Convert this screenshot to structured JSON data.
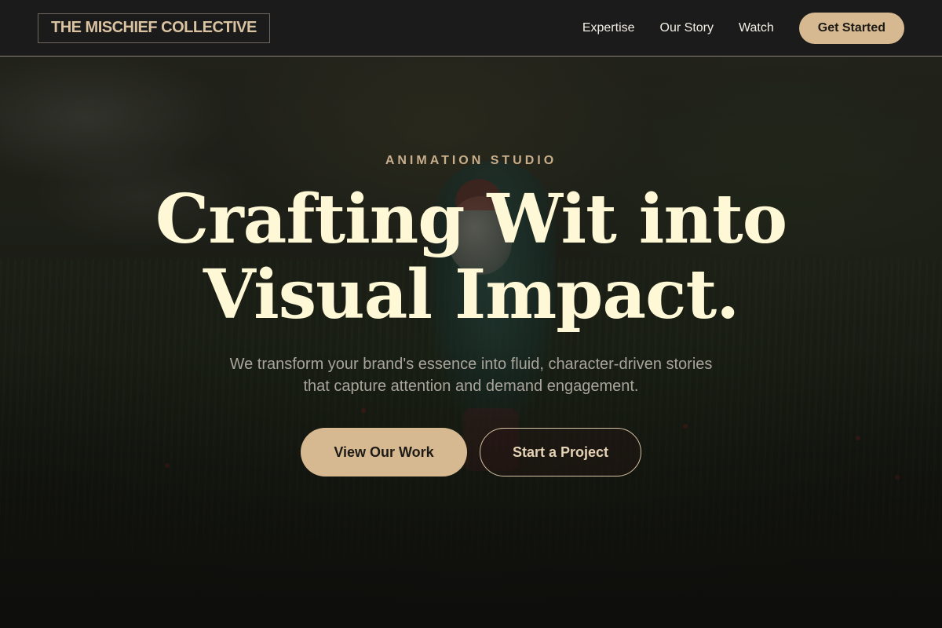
{
  "header": {
    "logo": "THE MISCHIEF COLLECTIVE",
    "nav": [
      {
        "label": "Expertise"
      },
      {
        "label": "Our Story"
      },
      {
        "label": "Watch"
      }
    ],
    "cta_label": "Get Started"
  },
  "hero": {
    "eyebrow": "ANIMATION STUDIO",
    "headline_line1": "Crafting Wit into",
    "headline_line2": "Visual Impact.",
    "lead_line1": "We transform your brand's essence into fluid, character-driven stories",
    "lead_line2": "that capture attention and demand engagement.",
    "primary_button": "View Our Work",
    "secondary_button": "Start a Project"
  },
  "colors": {
    "accent": "#d7b991",
    "headline": "#fff8d6",
    "eyebrow": "#c8ae8a",
    "navbar_bg": "#1b1b1b"
  }
}
